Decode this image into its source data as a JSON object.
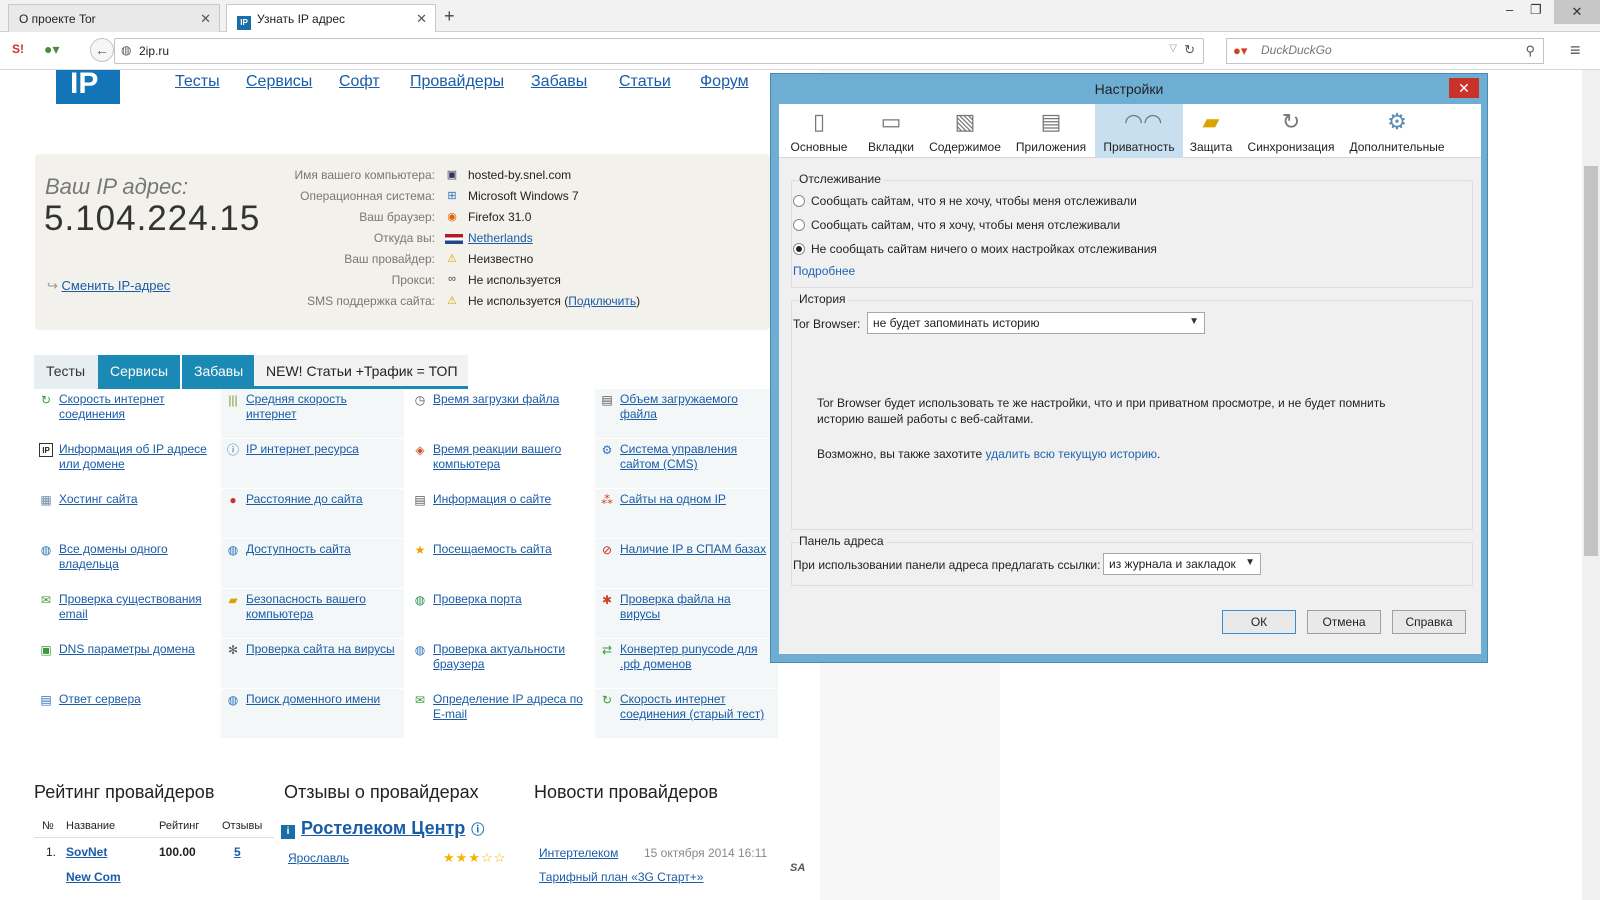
{
  "browser": {
    "tabs": [
      {
        "title": "О проекте Tor"
      },
      {
        "title": "Узнать IP адрес",
        "favicon_text": "IP"
      }
    ],
    "url": "2ip.ru",
    "search_placeholder": "DuckDuckGo",
    "icons": [
      "new-tab-icon",
      "minimize-icon",
      "maximize-icon",
      "close-icon",
      "back-icon",
      "reload-icon",
      "menu-icon",
      "search-icon"
    ]
  },
  "site": {
    "logo": "IP",
    "nav": [
      "Тесты",
      "Сервисы",
      "Софт",
      "Провайдеры",
      "Забавы",
      "Статьи",
      "Форум"
    ],
    "ip_label": "Ваш IP адрес:",
    "ip_value": "5.104.224.15",
    "change_ip": "Сменить IP-адрес",
    "info": [
      {
        "k": "Имя вашего компьютера:",
        "v": "hosted-by.snel.com",
        "icon": "monitor-icon"
      },
      {
        "k": "Операционная система:",
        "v": "Microsoft Windows 7",
        "icon": "windows-icon"
      },
      {
        "k": "Ваш браузер:",
        "v": "Firefox 31.0",
        "icon": "firefox-icon"
      },
      {
        "k": "Откуда вы:",
        "v": "Netherlands",
        "icon": "flag-icon"
      },
      {
        "k": "Ваш провайдер:",
        "v": "Неизвестно",
        "icon": "warning-icon"
      },
      {
        "k": "Прокси:",
        "v": "Не используется",
        "icon": "glasses-icon"
      },
      {
        "k": "SMS поддержка сайта:",
        "v": "Не используется (",
        "link": "Подключить",
        "tail": ")",
        "icon": "warning-icon"
      }
    ],
    "tabs": [
      "Тесты",
      "Сервисы",
      "Забавы",
      "NEW! Статьи +Трафик = ТОП"
    ],
    "services": [
      [
        "Скорость интернет соединения",
        "Средняя скорость интернет",
        "Время загрузки файла",
        "Объем загружаемого файла"
      ],
      [
        "Информация об IP адресе или домене",
        "IP интернет ресурса",
        "Время реакции вашего компьютера",
        "Система управления сайтом (CMS)"
      ],
      [
        "Хостинг сайта",
        "Расстояние до сайта",
        "Информация о сайте",
        "Сайты на одном IP"
      ],
      [
        "Все домены одного владельца",
        "Доступность сайта",
        "Посещаемость сайта",
        "Наличие IP в СПАМ базах"
      ],
      [
        "Проверка существования email",
        "Безопасность вашего компьютера",
        "Проверка порта",
        "Проверка файла на вирусы"
      ],
      [
        "DNS параметры домена",
        "Проверка сайта на вирусы",
        "Проверка актуальности браузера",
        "Конвертер punycode для .рф доменов"
      ],
      [
        "Ответ сервера",
        "Поиск доменного имени",
        "Определение IP адреса по E-mail",
        "Скорость интернет соединения (старый тест)"
      ]
    ],
    "sections": {
      "rating": "Рейтинг провайдеров",
      "reviews": "Отзывы о провайдерах",
      "news": "Новости провайдеров"
    },
    "rating_table": {
      "headers": [
        "№",
        "Название",
        "Рейтинг",
        "Отзывы"
      ],
      "rows": [
        {
          "n": "1.",
          "name": "SovNet",
          "rating": "100.00",
          "reviews": "5"
        },
        {
          "n": "",
          "name": "New Com",
          "rating": "",
          "reviews": ""
        }
      ]
    },
    "review": {
      "title": "Ростелеком Центр",
      "city": "Ярославль",
      "stars": "★★★☆☆"
    },
    "news": [
      {
        "title": "Интертелеком",
        "date": "15 октября 2014 16:11"
      },
      {
        "title": "Тарифный план «3G Старт+»",
        "date": ""
      }
    ]
  },
  "dialog": {
    "title": "Настройки",
    "toolbar": [
      "Основные",
      "Вкладки",
      "Содержимое",
      "Приложения",
      "Приватность",
      "Защита",
      "Синхронизация",
      "Дополнительные"
    ],
    "selected_tab": "Приватность",
    "tracking": {
      "label": "Отслеживание",
      "options": [
        "Сообщать сайтам, что я не хочу, чтобы меня отслеживали",
        "Сообщать сайтам, что я хочу, чтобы меня отслеживали",
        "Не сообщать сайтам ничего о моих настройках отслеживания"
      ],
      "selected_index": 2,
      "more_link": "Подробнее"
    },
    "history": {
      "label": "История",
      "field_label": "Tor Browser:",
      "select_value": "не будет запоминать историю",
      "desc1": "Tor Browser будет использовать те же настройки, что и при приватном просмотре, и не будет помнить историю вашей работы с веб-сайтами.",
      "desc2_prefix": "Возможно, вы также захотите ",
      "desc2_link": "удалить всю текущую историю",
      "desc2_suffix": "."
    },
    "address_bar": {
      "label": "Панель адреса",
      "field_label": "При использовании панели адреса предлагать ссылки:",
      "select_value": "из журнала и закладок"
    },
    "buttons": {
      "ok": "ОК",
      "cancel": "Отмена",
      "help": "Справка"
    },
    "accent": "#6eaed3"
  }
}
